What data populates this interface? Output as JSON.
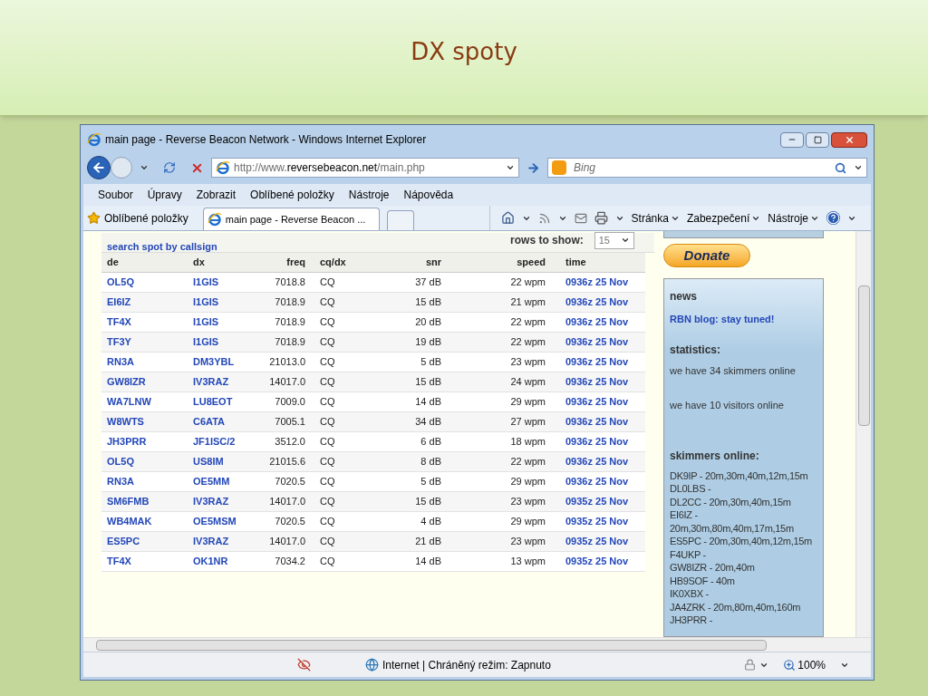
{
  "slide": {
    "title": "DX spoty"
  },
  "browser": {
    "window_title": "main page - Reverse Beacon Network - Windows Internet Explorer",
    "address": {
      "prefix": "http://www.",
      "domain": "reversebeacon.net",
      "path": "/main.php"
    },
    "search": {
      "placeholder": "Bing"
    },
    "menu": [
      "Soubor",
      "Úpravy",
      "Zobrazit",
      "Oblíbené položky",
      "Nástroje",
      "Nápověda"
    ],
    "favorites_label": "Oblíbené položky",
    "tabs": [
      {
        "label": "main page - Reverse Beacon ...",
        "selected": true
      }
    ],
    "commands": [
      "Stránka",
      "Zabezpečení",
      "Nástroje"
    ],
    "status": {
      "zone": "Internet | Chráněný režim: Zapnuto",
      "zoom": "100%"
    }
  },
  "page": {
    "search_link": "search spot by callsign",
    "rows_label": "rows to show:",
    "rows_value": "15",
    "table": {
      "columns": [
        "de",
        "dx",
        "freq",
        "cq/dx",
        "snr",
        "speed",
        "time"
      ],
      "rows": [
        [
          "OL5Q",
          "I1GIS",
          "7018.8",
          "CQ",
          "37 dB",
          "22 wpm",
          "0936z 25 Nov"
        ],
        [
          "EI6IZ",
          "I1GIS",
          "7018.9",
          "CQ",
          "15 dB",
          "21 wpm",
          "0936z 25 Nov"
        ],
        [
          "TF4X",
          "I1GIS",
          "7018.9",
          "CQ",
          "20 dB",
          "22 wpm",
          "0936z 25 Nov"
        ],
        [
          "TF3Y",
          "I1GIS",
          "7018.9",
          "CQ",
          "19 dB",
          "22 wpm",
          "0936z 25 Nov"
        ],
        [
          "RN3A",
          "DM3YBL",
          "21013.0",
          "CQ",
          "5 dB",
          "23 wpm",
          "0936z 25 Nov"
        ],
        [
          "GW8IZR",
          "IV3RAZ",
          "14017.0",
          "CQ",
          "15 dB",
          "24 wpm",
          "0936z 25 Nov"
        ],
        [
          "WA7LNW",
          "LU8EOT",
          "7009.0",
          "CQ",
          "14 dB",
          "29 wpm",
          "0936z 25 Nov"
        ],
        [
          "W8WTS",
          "C6ATA",
          "7005.1",
          "CQ",
          "34 dB",
          "27 wpm",
          "0936z 25 Nov"
        ],
        [
          "JH3PRR",
          "JF1ISC/2",
          "3512.0",
          "CQ",
          "6 dB",
          "18 wpm",
          "0936z 25 Nov"
        ],
        [
          "OL5Q",
          "US8IM",
          "21015.6",
          "CQ",
          "8 dB",
          "22 wpm",
          "0936z 25 Nov"
        ],
        [
          "RN3A",
          "OE5MM",
          "7020.5",
          "CQ",
          "5 dB",
          "29 wpm",
          "0936z 25 Nov"
        ],
        [
          "SM6FMB",
          "IV3RAZ",
          "14017.0",
          "CQ",
          "15 dB",
          "23 wpm",
          "0935z 25 Nov"
        ],
        [
          "WB4MAK",
          "OE5MSM",
          "7020.5",
          "CQ",
          "4 dB",
          "29 wpm",
          "0935z 25 Nov"
        ],
        [
          "ES5PC",
          "IV3RAZ",
          "14017.0",
          "CQ",
          "21 dB",
          "23 wpm",
          "0935z 25 Nov"
        ],
        [
          "TF4X",
          "OK1NR",
          "7034.2",
          "CQ",
          "14 dB",
          "13 wpm",
          "0935z 25 Nov"
        ]
      ]
    },
    "donate": "Donate",
    "news": {
      "heading": "news",
      "link": "RBN blog: stay tuned!"
    },
    "statistics": {
      "heading": "statistics:",
      "lines": [
        "we have 34 skimmers online",
        "we have 10 visitors online"
      ]
    },
    "skimmers": {
      "heading": "skimmers online:",
      "lines": [
        "DK9IP - 20m,30m,40m,12m,15m",
        "DL0LBS -",
        "DL2CC - 20m,30m,40m,15m",
        "EI6IZ - 20m,30m,80m,40m,17m,15m",
        "ES5PC - 20m,30m,40m,12m,15m",
        "F4UKP -",
        "GW8IZR - 20m,40m",
        "HB9SOF - 40m",
        "IK0XBX -",
        "JA4ZRK - 20m,80m,40m,160m",
        "JH3PRR -"
      ]
    }
  }
}
